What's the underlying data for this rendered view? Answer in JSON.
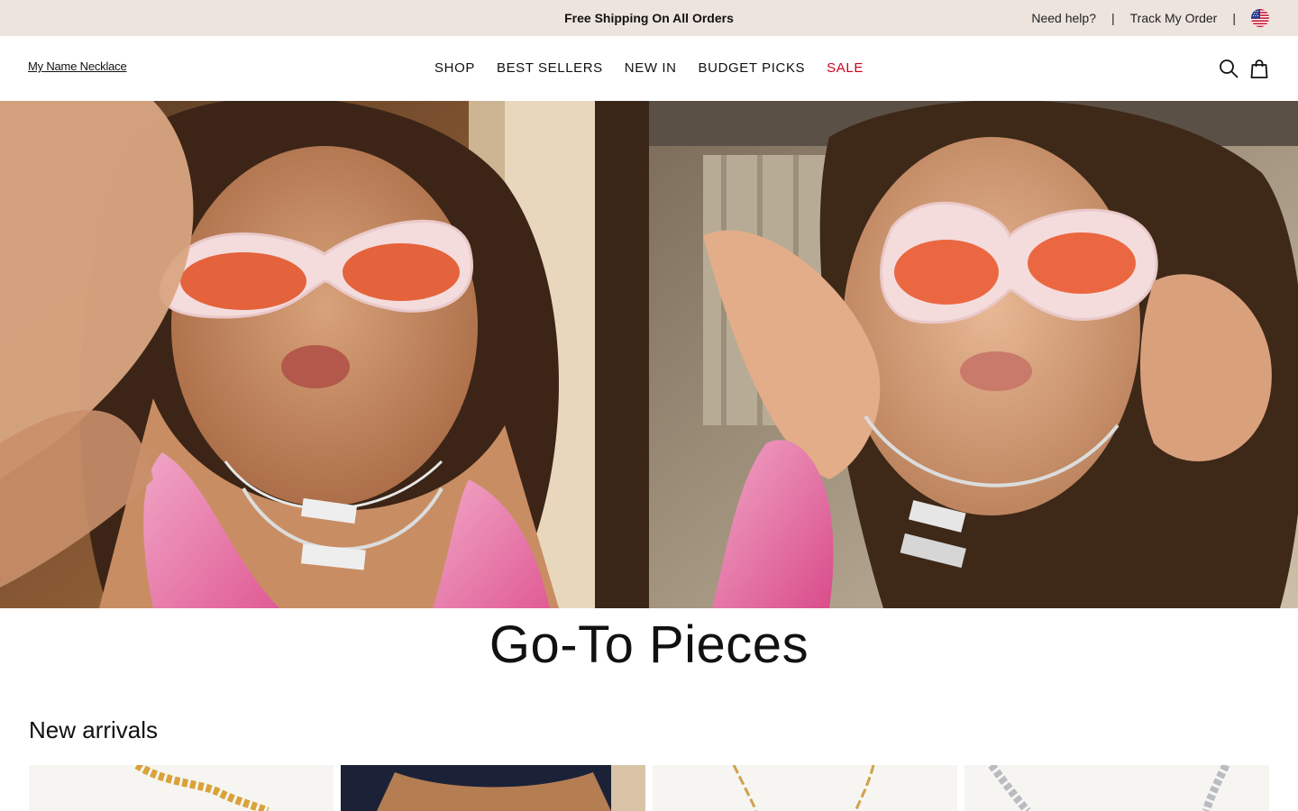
{
  "announcement": {
    "promo": "Free Shipping On All Orders",
    "help": "Need help?",
    "separator": "|",
    "track": "Track My Order",
    "flag_icon": "us-flag-icon"
  },
  "header": {
    "logo": "My Name Necklace",
    "nav": [
      "SHOP",
      "BEST SELLERS",
      "NEW IN",
      "BUDGET PICKS",
      "SALE"
    ],
    "sale_color": "#d0021b",
    "icons": [
      "search-icon",
      "shopping-bag-icon"
    ]
  },
  "hero": {
    "images": [
      "model-selfie-kiss-photo",
      "model-hands-on-face-photo"
    ]
  },
  "section": {
    "heading": "Go-To Pieces",
    "subheading": "New arrivals"
  },
  "products": {
    "cards": [
      "gold-curb-chain-photo",
      "model-torso-photo",
      "gold-paperclip-chain-photo",
      "silver-curb-chain-photo"
    ]
  },
  "colors": {
    "announcement_bg": "#ede4de",
    "product_bg": "#f5f5f2"
  }
}
